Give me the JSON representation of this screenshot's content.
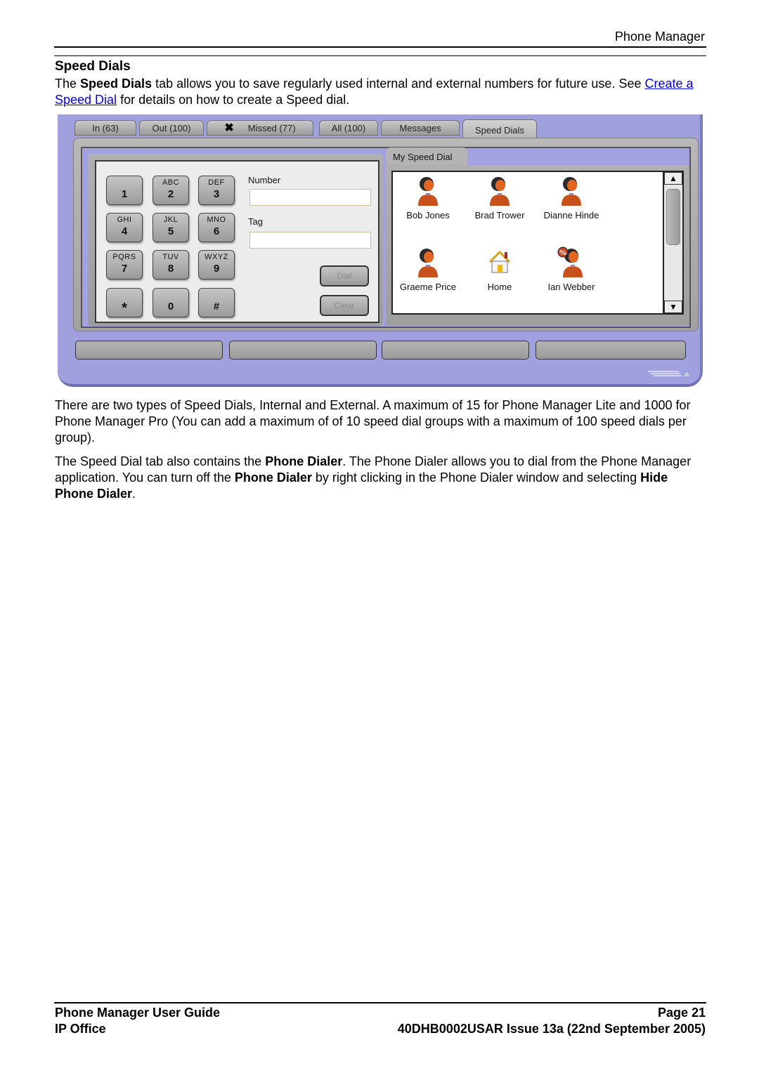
{
  "header": {
    "section_name": "Phone Manager"
  },
  "title": "Speed Dials",
  "intro": {
    "prefix": "The ",
    "bold": "Speed Dials",
    "middle": " tab allows you to save regularly used internal and external numbers for future use. See ",
    "link": "Create a Speed Dial",
    "suffix": " for details on how to create a Speed dial."
  },
  "app": {
    "tabs": [
      {
        "label": "In (63)"
      },
      {
        "label": "Out (100)"
      },
      {
        "label": "Missed (77)",
        "icon": "x-icon"
      },
      {
        "label": "All (100)"
      },
      {
        "label": "Messages"
      },
      {
        "label": "Speed Dials",
        "active": true
      }
    ],
    "dialer": {
      "keys": [
        {
          "letters": "",
          "digit": "1"
        },
        {
          "letters": "ABC",
          "digit": "2"
        },
        {
          "letters": "DEF",
          "digit": "3"
        },
        {
          "letters": "GHI",
          "digit": "4"
        },
        {
          "letters": "JKL",
          "digit": "5"
        },
        {
          "letters": "MNO",
          "digit": "6"
        },
        {
          "letters": "PQRS",
          "digit": "7"
        },
        {
          "letters": "TUV",
          "digit": "8"
        },
        {
          "letters": "WXYZ",
          "digit": "9"
        },
        {
          "letters": "",
          "digit": "*"
        },
        {
          "letters": "",
          "digit": "0"
        },
        {
          "letters": "",
          "digit": "#"
        }
      ],
      "number_label": "Number",
      "number_value": "",
      "tag_label": "Tag",
      "tag_value": "",
      "dial_label": "Dial",
      "clear_label": "Clear"
    },
    "speed_dial_group_tab": "My Speed Dial",
    "speed_dials": [
      {
        "name": "Bob Jones",
        "icon": "person-icon"
      },
      {
        "name": "Brad Trower",
        "icon": "person-icon"
      },
      {
        "name": "Dianne Hinde",
        "icon": "person-icon"
      },
      {
        "name": "Graeme Price",
        "icon": "person-icon"
      },
      {
        "name": "Home",
        "icon": "house-icon"
      },
      {
        "name": "Ian Webber",
        "icon": "person-busy-icon"
      }
    ],
    "colors": {
      "frame": "#9c9cdc",
      "panel": "#a8a8a8",
      "person": "#c8501a"
    }
  },
  "para1": "There are two types of Speed Dials, Internal and External. A maximum of 15 for Phone Manager Lite and 1000 for Phone Manager Pro (You can add a maximum of of 10 speed dial groups with a maximum of 100 speed dials per group).",
  "para2": {
    "t1": "The Speed Dial tab also contains the ",
    "b1": "Phone Dialer",
    "t2": ". The Phone Dialer allows you to dial from the Phone Manager application. You can turn off the ",
    "b2": "Phone Dialer",
    "t3": " by right clicking in the Phone Dialer window and selecting ",
    "b3": "Hide Phone Dialer",
    "t4": "."
  },
  "footer": {
    "guide": "Phone Manager User Guide",
    "product": "IP Office",
    "page": "Page 21",
    "issue": "40DHB0002USAR Issue 13a (22nd September 2005)"
  }
}
